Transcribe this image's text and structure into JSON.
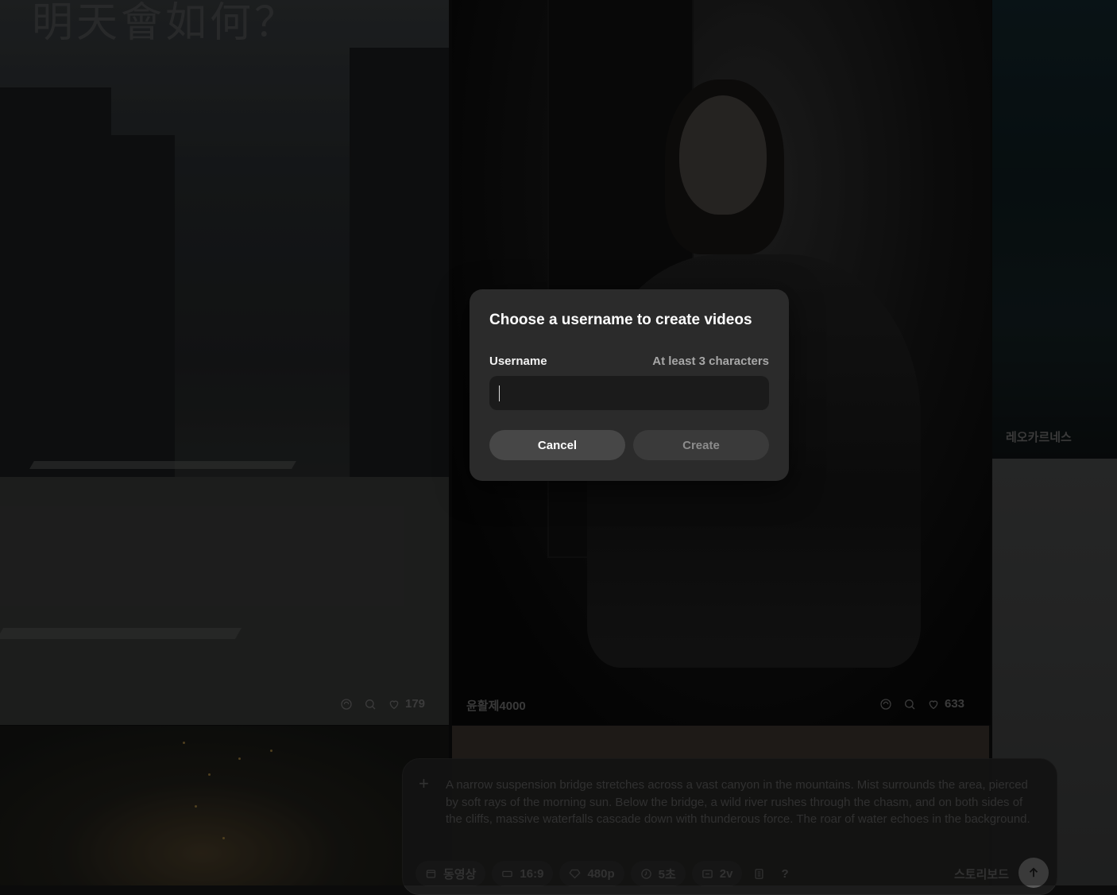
{
  "feed": {
    "city": {
      "headline": "明天會如何？",
      "likes": "179"
    },
    "knight": {
      "author": "윤활제4000",
      "likes": "633"
    },
    "sea": {
      "author": "레오카르네스"
    }
  },
  "composer": {
    "prompt": "A narrow suspension bridge stretches across a vast canyon in the mountains. Mist surrounds the area, pierced by soft rays of the morning sun. Below the bridge, a wild river rushes through the chasm, and on both sides of the cliffs, massive waterfalls cascade down with thunderous force. The roar of water echoes in the background.",
    "options": {
      "type": "동영상",
      "ratio": "16:9",
      "quality": "480p",
      "duration": "5초",
      "variations": "2v",
      "help": "?"
    },
    "storyboard": "스토리보드"
  },
  "modal": {
    "title": "Choose a username to create videos",
    "label": "Username",
    "hint": "At least 3 characters",
    "input_value": "",
    "cancel": "Cancel",
    "create": "Create"
  }
}
